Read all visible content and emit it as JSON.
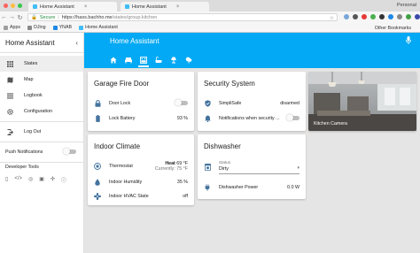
{
  "browser": {
    "tabs": [
      {
        "label": "Home Assistant",
        "active": true
      },
      {
        "label": "Home Assistant",
        "active": false
      }
    ],
    "profile": "Personal",
    "secure_label": "Secure",
    "url_host": "https://hass.bachho.me",
    "url_path": "/states/group.kitchen",
    "bookmarks": [
      "Apps",
      "DJing",
      "YNAB",
      "Home Assistant"
    ],
    "other_bookmarks": "Other Bookmarks"
  },
  "sidebar": {
    "title": "Home Assistant",
    "items": [
      {
        "label": "States",
        "icon": "grid-icon",
        "active": true
      },
      {
        "label": "Map",
        "icon": "map-icon",
        "active": false
      },
      {
        "label": "Logbook",
        "icon": "list-icon",
        "active": false
      },
      {
        "label": "Configuration",
        "icon": "gear-icon",
        "active": false
      },
      {
        "label": "Log Out",
        "icon": "exit-icon",
        "active": false
      }
    ],
    "push_label": "Push Notifications",
    "dev_tools_title": "Developer Tools"
  },
  "header": {
    "title": "Home Assistant",
    "view_icons": [
      "home-icon",
      "sofa-icon",
      "kitchen-icon",
      "bath-icon",
      "lamp-icon",
      "garden-icon"
    ]
  },
  "cards": {
    "garage": {
      "title": "Garage Fire Door",
      "rows": [
        {
          "name": "Door Lock",
          "value": ""
        },
        {
          "name": "Lock Battery",
          "value": "93 %"
        }
      ]
    },
    "security": {
      "title": "Security System",
      "rows": [
        {
          "name": "SimpliSafe",
          "value": "disarmed"
        },
        {
          "name": "Notifications when security ...",
          "value": ""
        }
      ]
    },
    "climate": {
      "title": "Indoor Climate",
      "thermostat": {
        "name": "Thermostat",
        "heat_label": "Heat",
        "heat_value": "69 °F",
        "current_label": "Currently:",
        "current_value": "75 °F"
      },
      "rows": [
        {
          "name": "Indoor Humidity",
          "value": "35 %"
        },
        {
          "name": "Indoor HVAC State",
          "value": "off"
        }
      ]
    },
    "dishwasher": {
      "title": "Dishwasher",
      "status_label": "Status",
      "status_value": "Dirty",
      "power_name": "Dishwasher Power",
      "power_value": "0.0 W"
    },
    "camera": {
      "label": "Kitchen Camera"
    }
  },
  "colors": {
    "accent": "#03a9f4",
    "icon": "#44739e"
  }
}
